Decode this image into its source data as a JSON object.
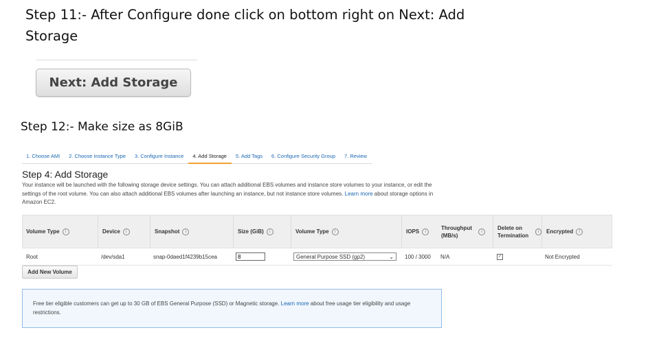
{
  "steps": {
    "step11": "Step 11:- After Configure done click on bottom right on Next: Add Storage",
    "next_button": "Next: Add Storage",
    "step12": "Step 12:- Make size as 8GiB"
  },
  "wizard": {
    "tabs": [
      "1. Choose AMI",
      "2. Choose Instance Type",
      "3. Configure Instance",
      "4. Add Storage",
      "5. Add Tags",
      "6. Configure Security Group",
      "7. Review"
    ],
    "active_tab": "4. Add Storage",
    "heading": "Step 4: Add Storage",
    "description": "Your instance will be launched with the following storage device settings. You can attach additional EBS volumes and instance store volumes to your instance, or edit the settings of the root volume. You can also attach additional EBS volumes after launching an instance, but not instance store volumes.",
    "learn_more": "Learn more",
    "description_end": "about storage options in Amazon EC2."
  },
  "table": {
    "headers": {
      "volume_type": "Volume Type",
      "device": "Device",
      "snapshot": "Snapshot",
      "size": "Size (GiB)",
      "volume_type2": "Volume Type",
      "iops": "IOPS",
      "throughput": "Throughput (MB/s)",
      "delete_on_termination": "Delete on Termination",
      "encrypted": "Encrypted"
    },
    "row": {
      "volume_type": "Root",
      "device": "/dev/sda1",
      "snapshot": "snap-0daed1f4239b15cea",
      "size": "8",
      "volume_type_select": "General Purpose SSD (gp2)",
      "iops": "100 / 3000",
      "throughput": "N/A",
      "delete_on_termination_checked": true,
      "encrypted": "Not Encrypted"
    }
  },
  "add_volume_label": "Add New Volume",
  "notice": {
    "text": "Free tier eligible customers can get up to 30 GB of EBS General Purpose (SSD) or Magnetic storage.",
    "learn_more": "Learn more",
    "text_end": "about free usage tier eligibility and usage restrictions."
  },
  "icons": {
    "info": "info-icon",
    "dropdown": "chevron-down-icon",
    "checkbox": "check-icon"
  },
  "colors": {
    "link": "#1a66b2",
    "active_tab_underline": "#f0a030",
    "notice_border": "#8fbce6"
  }
}
